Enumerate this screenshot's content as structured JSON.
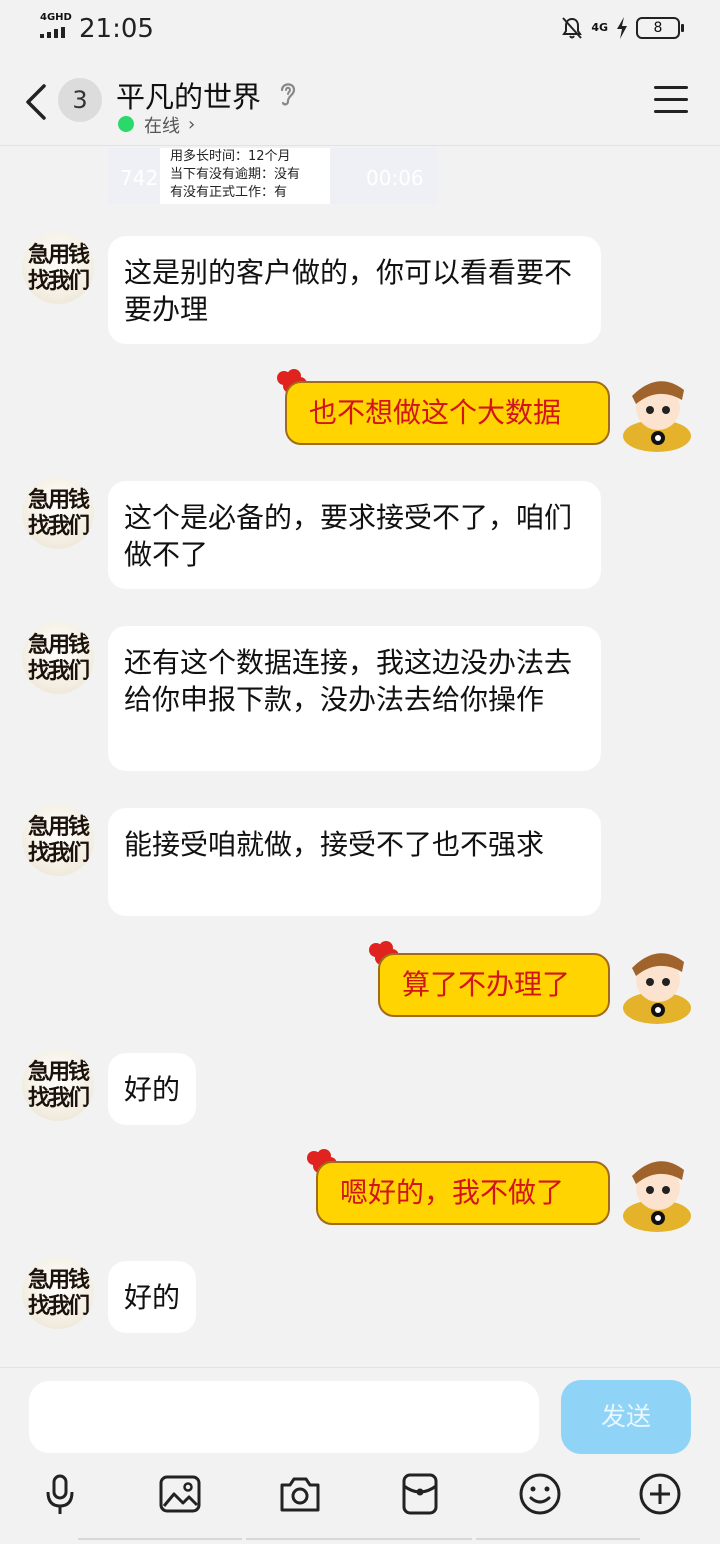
{
  "status_bar": {
    "network": "4GHD",
    "time": "21:05",
    "network_right": "4G",
    "battery": "8"
  },
  "header": {
    "unread_count": "3",
    "contact_name": "平凡的世界",
    "status": "在线"
  },
  "preview_image": {
    "left_text": "742",
    "right_text": "00:06",
    "lines": [
      "用多长时间：12个月",
      "当下有没有逾期：没有",
      "有没有正式工作：有"
    ]
  },
  "messages": [
    {
      "side": "left",
      "text": "这是别的客户做的，你可以看看要不要办理"
    },
    {
      "side": "right",
      "text": "也不想做这个大数据"
    },
    {
      "side": "left",
      "text": "这个是必备的，要求接受不了，咱们做不了"
    },
    {
      "side": "left",
      "text": "还有这个数据连接，我这边没办法去给你申报下款，没办法去给你操作"
    },
    {
      "side": "left",
      "text": "能接受咱就做，接受不了也不强求"
    },
    {
      "side": "right",
      "text": "算了不办理了"
    },
    {
      "side": "left",
      "text": "好的"
    },
    {
      "side": "right",
      "text": "嗯好的，我不做了"
    },
    {
      "side": "left",
      "text": "好的"
    }
  ],
  "avatar_left_text": "急用钱找我们",
  "input": {
    "send_label": "发送",
    "placeholder": ""
  },
  "toolbar_icons": [
    "microphone-icon",
    "image-icon",
    "camera-icon",
    "red-packet-icon",
    "emoji-icon",
    "plus-icon"
  ],
  "colors": {
    "background": "#f2f2f2",
    "right_bubble": "#ffd400",
    "right_text": "#d2141b",
    "send_button": "#8fd3f7",
    "online": "#2bd96b"
  }
}
